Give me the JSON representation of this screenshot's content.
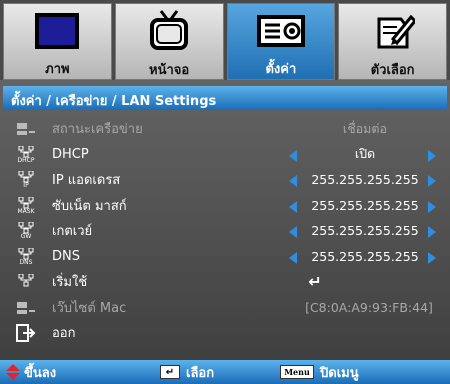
{
  "tabs": [
    {
      "label": "ภาพ",
      "icon": "picture-icon"
    },
    {
      "label": "หน้าจอ",
      "icon": "tv-icon"
    },
    {
      "label": "ตั้งค่า",
      "icon": "projector-icon"
    },
    {
      "label": "ตัวเลือก",
      "icon": "options-icon"
    }
  ],
  "title": "ตั้งค่า / เครือข่าย / LAN Settings",
  "rows": [
    {
      "label": "สถานะเครือข่าย",
      "value": "เชื่อมต่อ",
      "icon": "network-status-icon",
      "icon_text": ""
    },
    {
      "label": "DHCP",
      "value": "เปิด",
      "icon": "dhcp-icon",
      "icon_text": "DHCP"
    },
    {
      "label": "IP แอดเดรส",
      "value": "255.255.255.255",
      "icon": "ip-icon",
      "icon_text": "IP"
    },
    {
      "label": "ซับเน็ต มาสก์",
      "value": "255.255.255.255",
      "icon": "mask-icon",
      "icon_text": "MASK"
    },
    {
      "label": "เกตเวย์",
      "value": "255.255.255.255",
      "icon": "gateway-icon",
      "icon_text": "GW"
    },
    {
      "label": "DNS",
      "value": "255.255.255.255",
      "icon": "dns-icon",
      "icon_text": "DNS"
    },
    {
      "label": "เริ่มใช้",
      "value": "↵",
      "icon": "apply-icon",
      "icon_text": ""
    },
    {
      "label": "เว๊บไซต์ Mac",
      "value": "[C8:0A:A9:93:FB:44]",
      "icon": "mac-icon",
      "icon_text": ""
    },
    {
      "label": "ออก",
      "value": "",
      "icon": "exit-icon",
      "icon_text": ""
    }
  ],
  "footer": {
    "updown": "ขึ้นลง",
    "select": "เลือก",
    "menu_key": "Menu",
    "close": "ปิดเมนู"
  }
}
